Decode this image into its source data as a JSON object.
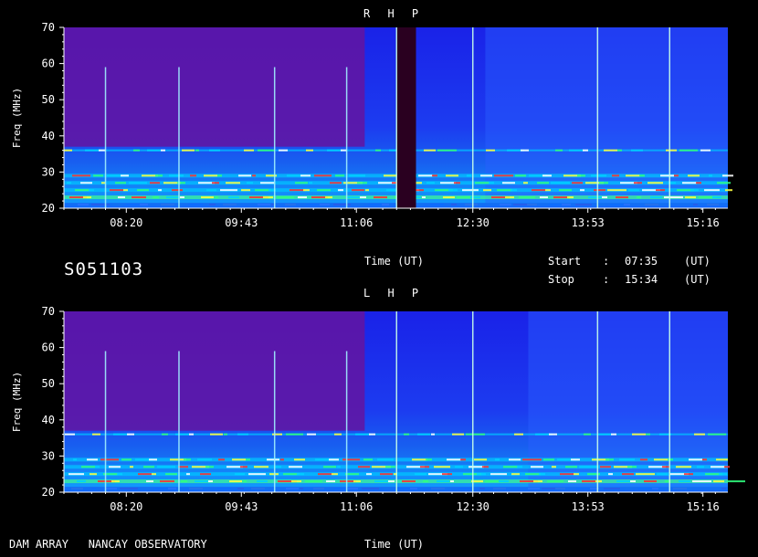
{
  "footer": {
    "instrument": "DAM ARRAY   NANCAY OBSERVATORY"
  },
  "header": {
    "date_id": "S051103",
    "start_label": "Start",
    "start_value": "07:35",
    "start_unit": "(UT)",
    "stop_label": "Stop",
    "stop_value": "15:34",
    "stop_unit": "(UT)",
    "colon": ":"
  },
  "chart_data": [
    {
      "type": "heatmap",
      "title": "R H P",
      "xlabel": "Time (UT)",
      "ylabel": "Freq (MHz)",
      "xlim": [
        "07:35",
        "15:34"
      ],
      "ylim": [
        20,
        70
      ],
      "xticks": [
        "08:20",
        "09:43",
        "11:06",
        "12:30",
        "13:53",
        "15:16"
      ],
      "yticks": [
        20,
        30,
        40,
        50,
        60,
        70
      ],
      "emission_bands_mhz": [
        21,
        23,
        25,
        27,
        29,
        36
      ],
      "vertical_bursts_ut": [
        "08:05",
        "08:58",
        "10:07",
        "10:59",
        "11:35",
        "12:30",
        "14:00",
        "14:52"
      ],
      "data_gap_ut": [
        "11:35",
        "11:49"
      ],
      "colors": {
        "low": "#2828ff",
        "mid": "#00e0ff",
        "high": "#ff2020",
        "background": "#6414a0"
      }
    },
    {
      "type": "heatmap",
      "title": "L H P",
      "xlabel": "Time (UT)",
      "ylabel": "Freq (MHz)",
      "xlim": [
        "07:35",
        "15:34"
      ],
      "ylim": [
        20,
        70
      ],
      "xticks": [
        "08:20",
        "09:43",
        "11:06",
        "12:30",
        "13:53",
        "15:16"
      ],
      "yticks": [
        20,
        30,
        40,
        50,
        60,
        70
      ],
      "emission_bands_mhz": [
        21,
        23,
        25,
        27,
        29,
        36
      ],
      "vertical_bursts_ut": [
        "08:05",
        "08:58",
        "10:07",
        "10:59",
        "11:35",
        "12:30",
        "14:00",
        "14:52"
      ],
      "colors": {
        "low": "#2828ff",
        "mid": "#00e0ff",
        "high": "#ff2020",
        "background": "#6414a0"
      }
    }
  ]
}
